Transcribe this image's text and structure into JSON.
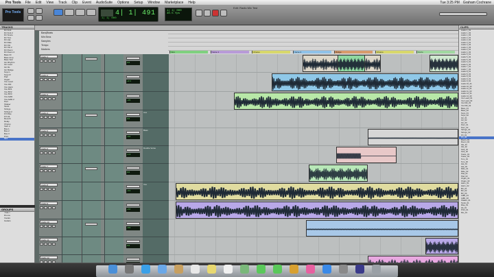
{
  "menubar": {
    "apple": "",
    "app_name": "Pro Tools",
    "items": [
      "File",
      "Edit",
      "View",
      "Track",
      "Clip",
      "Event",
      "AudioSuite",
      "Options",
      "Setup",
      "Window",
      "Marketplace",
      "Help"
    ],
    "right": [
      "Tue 3:25 PM",
      "Graham Cochrane"
    ]
  },
  "window": {
    "title": "Edit: Radio Mix Test"
  },
  "transport": {
    "main_counter": "4| 1| 491",
    "sub_counter": "1| 1| 000",
    "mini_a": "1| 1| 000",
    "mini_b": "30.5 fps",
    "logo": "Pro Tools"
  },
  "tracks_pane": {
    "title": "TRACKS",
    "items": [
      "Dir Kick",
      "Dir Kick 2",
      "Dir Snare",
      "Dir Tom",
      "Dir Hat",
      "Dir Ride",
      "Dir OH",
      "Dir OH 2",
      "Dir Room",
      "Dir Room 2",
      "Bass DI",
      "Bass Amp",
      "Bass Sub",
      "Gtr Rhythm",
      "Gtr Lead",
      "Gtr DL",
      "Gtr Bridge",
      "Keys L",
      "Keys R",
      "Pad",
      "Organ",
      "Vox Lead",
      "Vox Dbl",
      "Vox Harm",
      "Vox BV1",
      "Vox BV2",
      "Vox BV3",
      "Vox Adlib",
      "Vox Adlib 2",
      "Perc",
      "Shaker",
      "Tamb",
      "Strings",
      "Strings 2",
      "FX Rise",
      "FX Hit",
      "Reverb",
      "Delay",
      "Chorus",
      "Verb 2",
      "Bus 1",
      "Bus 2",
      "Bus 3",
      "Print",
      "MIX"
    ],
    "selected_index": 44
  },
  "groups_pane": {
    "title": "GROUPS",
    "items": [
      "<ALL>",
      "Drums",
      "Vocals",
      "Guitars"
    ]
  },
  "edit_window": {
    "ruler_labels": [
      "Bars|Beats",
      "Min:Secs",
      "Samples",
      "Tempo",
      "Markers"
    ],
    "tracks": [
      {
        "name": "Audio 1",
        "vol": "0.0",
        "comment": ""
      },
      {
        "name": "Audio 2",
        "vol": "+2.1",
        "comment": ""
      },
      {
        "name": "Audio 3",
        "vol": "-4.5",
        "comment": ""
      },
      {
        "name": "Audio 4",
        "vol": "0.0",
        "comment": "Aux"
      },
      {
        "name": "Audio 5",
        "vol": "-6.0",
        "comment": "Bass"
      },
      {
        "name": "Audio 6",
        "vol": "-1.3",
        "comment": "Double Verse"
      },
      {
        "name": "Audio 7",
        "vol": "0.0",
        "comment": ""
      },
      {
        "name": "Audio 8",
        "vol": "-3.2",
        "comment": "Vox"
      },
      {
        "name": "Audio 9",
        "vol": "-2.0",
        "comment": ""
      },
      {
        "name": "Audio 10",
        "vol": "-5.5",
        "comment": ""
      },
      {
        "name": "Audio 11",
        "vol": "0.0",
        "comment": ""
      },
      {
        "name": "Audio 12",
        "vol": "-8.0",
        "comment": ""
      }
    ],
    "markers": [
      "Intro",
      "Verse 1",
      "Chorus",
      "Verse 2",
      "Bridge",
      "Chorus",
      "Outro"
    ]
  },
  "clips_pane": {
    "title": "CLIPS",
    "items": [
      "Audio 1_01",
      "Audio 1_02",
      "Audio 1_03",
      "Audio 2_01",
      "Audio 2_02",
      "Audio 3_01",
      "Audio 3_02",
      "Audio 3_03",
      "Audio 4_01",
      "Audio 4_02",
      "Audio 5_01",
      "Audio 5_02",
      "Audio 5_03",
      "Audio 6_01",
      "Audio 6_02",
      "Audio 7_01",
      "Audio 7_02",
      "Audio 8_01",
      "Audio 8_02",
      "Audio 8_03",
      "Audio 9_01",
      "Audio 9_02",
      "Audio 10_01",
      "Audio 10_02",
      "Audio 11_01",
      "Audio 11_02",
      "Audio 12_01",
      "Audio 12_02",
      "Vox Lead_01",
      "Vox Lead_02",
      "Vox Dbl_01",
      "Vox Dbl_02",
      "Bass_01",
      "Bass_02",
      "Keys_01",
      "Keys_02",
      "Gtr_01",
      "Gtr_02",
      "Gtr_03",
      "Perc_01",
      "Perc_02",
      "Strings_01",
      "Strings_02",
      "FX_01",
      "FX_02",
      "Room_01",
      "Room_02",
      "OH_01",
      "OH_02",
      "Kick_01",
      "Kick_02",
      "Snare_01",
      "Snare_02",
      "Tom_01",
      "Tom_02",
      "Hat_01",
      "Hat_02",
      "Ride_01",
      "Ride_02",
      "Pad_01",
      "Pad_02",
      "Organ_01",
      "Organ_02",
      "Harm_01",
      "Harm_02",
      "BV_01",
      "BV_02",
      "BV_03",
      "Adlib_01",
      "Adlib_02",
      "Shaker_01",
      "Tamb_01",
      "Rise_01",
      "Hit_01",
      "Print_01",
      "Mix_01"
    ],
    "selected_index": 44
  },
  "dock": {
    "icons": [
      "finder-icon",
      "launchpad-icon",
      "safari-icon",
      "mail-icon",
      "contacts-icon",
      "calendar-icon",
      "notes-icon",
      "reminders-icon",
      "maps-icon",
      "messages-icon",
      "facetime-icon",
      "photo-icon",
      "itunes-icon",
      "appstore-icon",
      "preferences-icon",
      "protools-icon",
      "trash-icon"
    ]
  }
}
